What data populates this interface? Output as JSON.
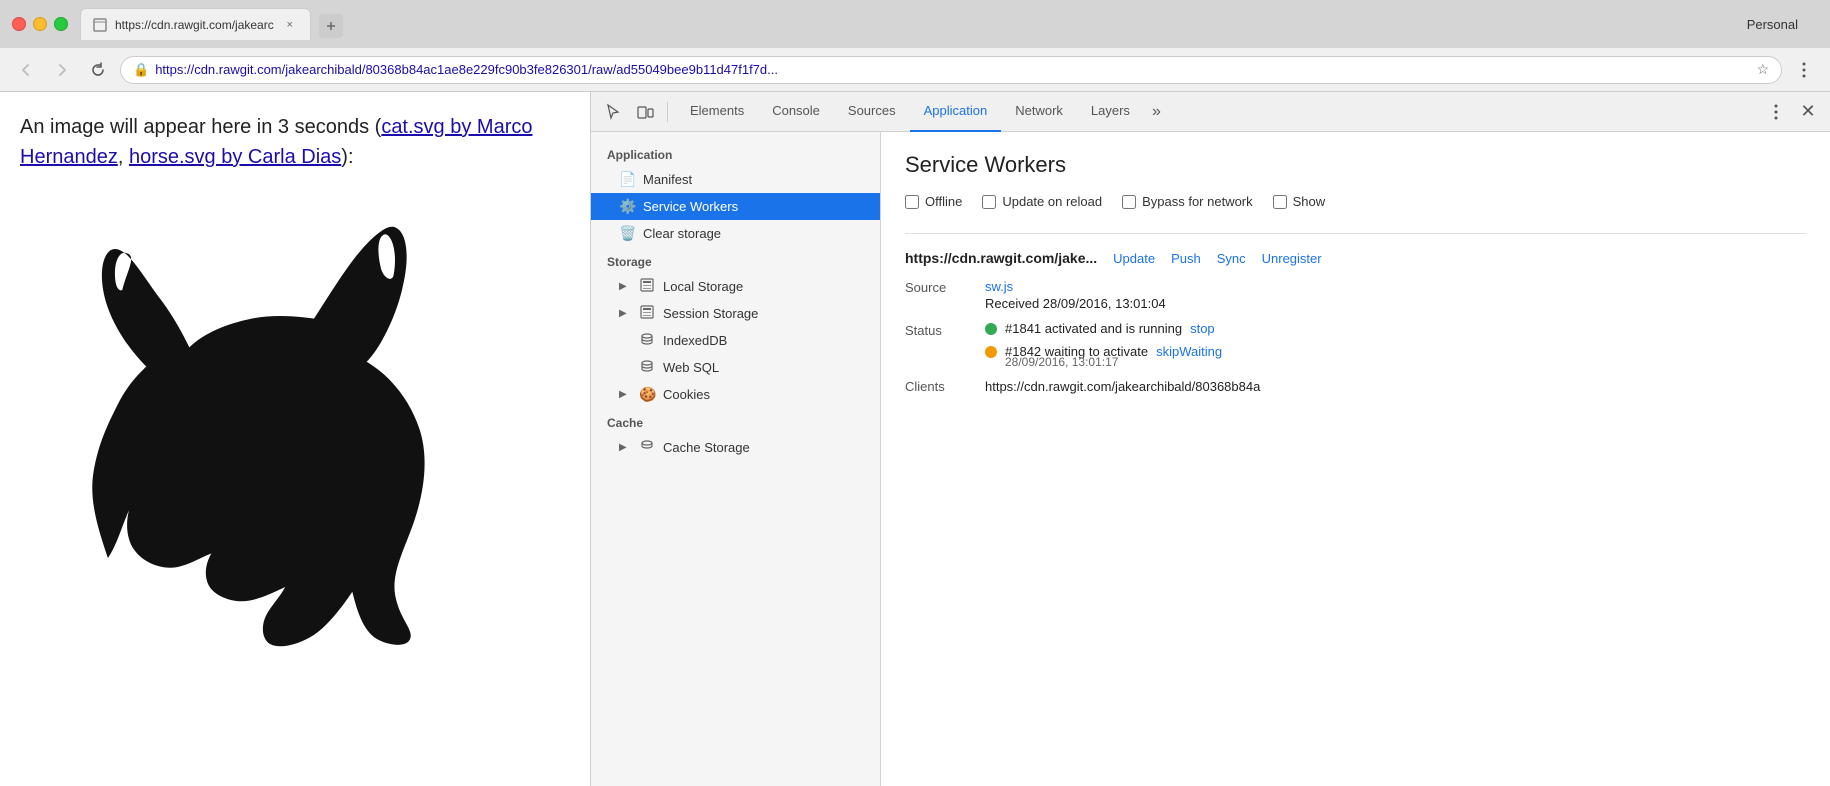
{
  "browser": {
    "profile": "Personal",
    "tab": {
      "title": "https://cdn.rawgit.com/jakearc",
      "close_label": "×"
    },
    "address": {
      "url": "https://cdn.rawgit.com/jakearchibald/80368b84ac1ae8e229fc90b3fe826301/raw/ad55049bee9b11d47f1f7d...",
      "full_url": "https://cdn.rawgit.com/jakearchibald/80368b84ac1ae8e229fc90b3fe826301/raw/ad55049bee9b11d47f1f7d..."
    }
  },
  "page": {
    "text_before": "An image will appear here in 3 seconds (",
    "link1_text": "cat.svg by Marco Hernandez",
    "link1_separator": ", ",
    "link2_text": "horse.svg by Carla Dias",
    "text_after": "):"
  },
  "devtools": {
    "tabs": [
      {
        "id": "elements",
        "label": "Elements"
      },
      {
        "id": "console",
        "label": "Console"
      },
      {
        "id": "sources",
        "label": "Sources"
      },
      {
        "id": "application",
        "label": "Application",
        "active": true
      },
      {
        "id": "network",
        "label": "Network"
      },
      {
        "id": "layers",
        "label": "Layers"
      }
    ],
    "more_tabs_label": "»",
    "sidebar": {
      "app_section_label": "Application",
      "app_items": [
        {
          "id": "manifest",
          "label": "Manifest",
          "icon": "📄"
        },
        {
          "id": "service-workers",
          "label": "Service Workers",
          "icon": "⚙️",
          "active": true
        },
        {
          "id": "clear-storage",
          "label": "Clear storage",
          "icon": "🗑️"
        }
      ],
      "storage_section_label": "Storage",
      "storage_items": [
        {
          "id": "local-storage",
          "label": "Local Storage",
          "expandable": true,
          "icon": "▦"
        },
        {
          "id": "session-storage",
          "label": "Session Storage",
          "expandable": true,
          "icon": "▦"
        },
        {
          "id": "indexeddb",
          "label": "IndexedDB",
          "icon": "🗄️"
        },
        {
          "id": "web-sql",
          "label": "Web SQL",
          "icon": "🗄️"
        },
        {
          "id": "cookies",
          "label": "Cookies",
          "expandable": true,
          "icon": "🍪"
        }
      ],
      "cache_section_label": "Cache",
      "cache_items": [
        {
          "id": "cache-storage",
          "label": "Cache Storage",
          "expandable": true,
          "icon": "🗄️"
        }
      ]
    },
    "main": {
      "title": "Service Workers",
      "checkboxes": [
        {
          "id": "offline",
          "label": "Offline",
          "checked": false
        },
        {
          "id": "update-on-reload",
          "label": "Update on reload",
          "checked": false
        },
        {
          "id": "bypass-for-network",
          "label": "Bypass for network",
          "checked": false
        },
        {
          "id": "show",
          "label": "Show",
          "checked": false
        }
      ],
      "sw_entry": {
        "url": "https://cdn.rawgit.com/jake...",
        "actions": [
          {
            "id": "update",
            "label": "Update"
          },
          {
            "id": "push",
            "label": "Push"
          },
          {
            "id": "sync",
            "label": "Sync"
          },
          {
            "id": "unregister",
            "label": "Unregister"
          }
        ],
        "source_label": "Source",
        "source_file": "sw.js",
        "received": "Received 28/09/2016, 13:01:04",
        "status_label": "Status",
        "statuses": [
          {
            "dot": "green",
            "text": "#1841 activated and is running",
            "action": "stop",
            "sub": null
          },
          {
            "dot": "orange",
            "text": "#1842 waiting to activate",
            "action": "skipWaiting",
            "sub": "28/09/2016, 13:01:17"
          }
        ],
        "clients_label": "Clients",
        "clients_value": "https://cdn.rawgit.com/jakearchibald/80368b84a"
      }
    }
  }
}
